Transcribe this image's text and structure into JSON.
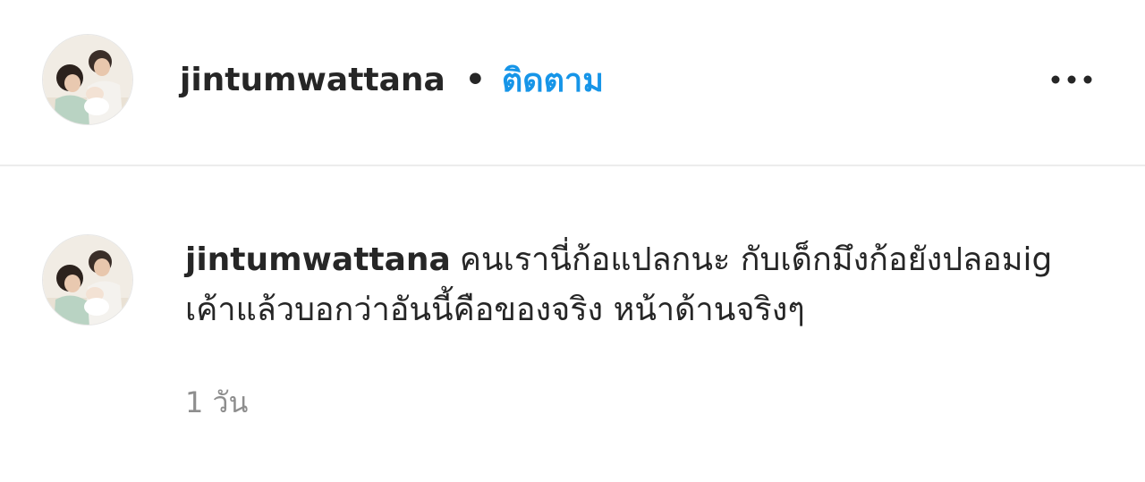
{
  "post_header": {
    "username": "jintumwattana",
    "separator": "•",
    "follow_label": "ติดตาม",
    "more_icon": "more-horizontal-icon"
  },
  "comment": {
    "username": "jintumwattana",
    "text": "คนเรานี่ก้อแปลกนะ กับเด็กมึงก้อยังปลอมig เค้าแล้วบอกว่าอันนี้คือของจริง หน้าด้านจริงๆ",
    "time_ago": "1 วัน"
  },
  "colors": {
    "accent": "#1695e8",
    "text": "#262626",
    "muted": "#8e8e8e",
    "divider": "#ececec"
  }
}
